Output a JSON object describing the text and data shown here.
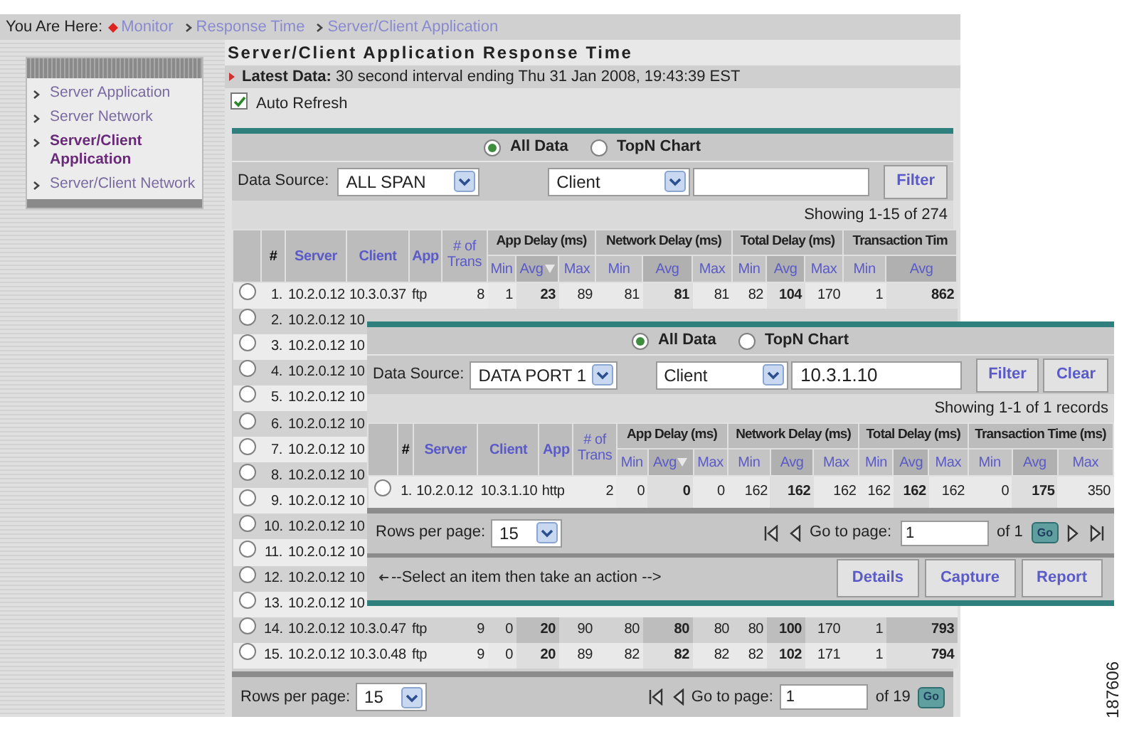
{
  "breadcrumb": {
    "label": "You Are Here:",
    "items": [
      {
        "label": "Monitor",
        "kind": "home"
      },
      {
        "label": "Response Time",
        "kind": "link"
      },
      {
        "label": "Server/Client Application",
        "kind": "link"
      }
    ]
  },
  "sidebar": {
    "items": [
      {
        "label": "Server Application",
        "selected": false
      },
      {
        "label": "Server Network",
        "selected": false
      },
      {
        "label": "Server/Client Application",
        "selected": true
      },
      {
        "label": "Server/Client Network",
        "selected": false
      }
    ]
  },
  "page_title": "Server/Client Application Response Time",
  "latest_data": "**Latest Data:** 30 second interval ending Thu 31 Jan 2008, 19:43:39 EST",
  "auto_refresh": {
    "label": "Auto Refresh",
    "checked": true
  },
  "main_panel": {
    "view_options": [
      {
        "label": "All Data",
        "selected": true
      },
      {
        "label": "TopN Chart",
        "selected": false
      }
    ],
    "data_source": {
      "label": "Data Source:",
      "value": "ALL SPAN"
    },
    "filter_by": "Client",
    "buttons": [
      "Filter"
    ],
    "showing": "Showing 1-15 of 274",
    "columns": [
      "#",
      "Server",
      "Client",
      "App",
      "# of Trans"
    ],
    "groups": [
      {
        "label": "App Delay (ms)",
        "subs": [
          {
            "label": "Min",
            "emphasis": false,
            "sorted": false
          },
          {
            "label": "Avg",
            "emphasis": true,
            "sorted": true
          },
          {
            "label": "Max",
            "emphasis": false,
            "sorted": false
          }
        ]
      },
      {
        "label": "Network Delay (ms)",
        "subs": [
          {
            "label": "Min",
            "emphasis": false,
            "sorted": false
          },
          {
            "label": "Avg",
            "emphasis": true,
            "sorted": false
          },
          {
            "label": "Max",
            "emphasis": false,
            "sorted": false
          }
        ]
      },
      {
        "label": "Total Delay (ms)",
        "subs": [
          {
            "label": "Min",
            "emphasis": false,
            "sorted": false
          },
          {
            "label": "Avg",
            "emphasis": true,
            "sorted": false
          },
          {
            "label": "Max",
            "emphasis": false,
            "sorted": false
          }
        ]
      },
      {
        "label": "Transaction Tim",
        "subs": [
          {
            "label": "Min",
            "emphasis": false,
            "sorted": false
          },
          {
            "label": "Avg",
            "emphasis": true,
            "sorted": false
          }
        ]
      }
    ],
    "rows": [
      {
        "number": "1.",
        "server": "10.2.0.12",
        "client": "10.3.0.37",
        "app": "ftp",
        "trans": "8",
        "values": [
          "1",
          "23",
          "89",
          "81",
          "81",
          "81",
          "82",
          "104",
          "170",
          "1",
          "862"
        ],
        "selected": false
      },
      {
        "number": "2.",
        "server": "10.2.0.12",
        "client": "10",
        "selected": false
      },
      {
        "number": "3.",
        "server": "10.2.0.12",
        "client": "10",
        "selected": false
      },
      {
        "number": "4.",
        "server": "10.2.0.12",
        "client": "10",
        "selected": false
      },
      {
        "number": "5.",
        "server": "10.2.0.12",
        "client": "10",
        "selected": false
      },
      {
        "number": "6.",
        "server": "10.2.0.12",
        "client": "10",
        "selected": false
      },
      {
        "number": "7.",
        "server": "10.2.0.12",
        "client": "10",
        "selected": false
      },
      {
        "number": "8.",
        "server": "10.2.0.12",
        "client": "10",
        "selected": false
      },
      {
        "number": "9.",
        "server": "10.2.0.12",
        "client": "10",
        "selected": false
      },
      {
        "number": "10.",
        "server": "10.2.0.12",
        "client": "10",
        "selected": false
      },
      {
        "number": "11.",
        "server": "10.2.0.12",
        "client": "10",
        "selected": false
      },
      {
        "number": "12.",
        "server": "10.2.0.12",
        "client": "10",
        "selected": false
      },
      {
        "number": "13.",
        "server": "10.2.0.12",
        "client": "10",
        "selected": false
      },
      {
        "number": "14.",
        "server": "10.2.0.12",
        "client": "10.3.0.47",
        "app": "ftp",
        "trans": "9",
        "values": [
          "0",
          "20",
          "90",
          "80",
          "80",
          "80",
          "80",
          "100",
          "170",
          "1",
          "793"
        ],
        "selected": false
      },
      {
        "number": "15.",
        "server": "10.2.0.12",
        "client": "10.3.0.48",
        "app": "ftp",
        "trans": "9",
        "values": [
          "0",
          "20",
          "89",
          "82",
          "82",
          "82",
          "82",
          "102",
          "171",
          "1",
          "794"
        ],
        "selected": false
      }
    ],
    "pagination": {
      "rows_label": "Rows per page:",
      "rows_value": "15",
      "goto_label": "Go to page:",
      "page": "1",
      "of": "of 19",
      "go": "Go"
    }
  },
  "overlay_panel": {
    "view_options": [
      {
        "label": "All Data",
        "selected": true
      },
      {
        "label": "TopN Chart",
        "selected": false
      }
    ],
    "data_source": {
      "label": "Data Source:",
      "value": "DATA PORT 1"
    },
    "filter_by": "Client",
    "filter_value": "10.3.1.10",
    "buttons": [
      "Filter",
      "Clear"
    ],
    "showing": "Showing 1-1 of 1 records",
    "columns": [
      "#",
      "Server",
      "Client",
      "App",
      "# of Trans"
    ],
    "groups": [
      {
        "label": "App Delay (ms)",
        "subs": [
          {
            "label": "Min",
            "emphasis": false,
            "sorted": false
          },
          {
            "label": "Avg",
            "emphasis": true,
            "sorted": true
          },
          {
            "label": "Max",
            "emphasis": false,
            "sorted": false
          }
        ]
      },
      {
        "label": "Network Delay (ms)",
        "subs": [
          {
            "label": "Min",
            "emphasis": false,
            "sorted": false
          },
          {
            "label": "Avg",
            "emphasis": true,
            "sorted": false
          },
          {
            "label": "Max",
            "emphasis": false,
            "sorted": false
          }
        ]
      },
      {
        "label": "Total Delay (ms)",
        "subs": [
          {
            "label": "Min",
            "emphasis": false,
            "sorted": false
          },
          {
            "label": "Avg",
            "emphasis": true,
            "sorted": false
          },
          {
            "label": "Max",
            "emphasis": false,
            "sorted": false
          }
        ]
      },
      {
        "label": "Transaction Time (ms)",
        "subs": [
          {
            "label": "Min",
            "emphasis": false,
            "sorted": false
          },
          {
            "label": "Avg",
            "emphasis": true,
            "sorted": false
          },
          {
            "label": "Max",
            "emphasis": false,
            "sorted": false
          }
        ]
      }
    ],
    "rows": [
      {
        "number": "1.",
        "server": "10.2.0.12",
        "client": "10.3.1.10",
        "app": "http",
        "trans": "2",
        "values": [
          "0",
          "0",
          "0",
          "162",
          "162",
          "162",
          "162",
          "162",
          "162",
          "0",
          "175",
          "350"
        ],
        "selected": false
      }
    ],
    "pagination": {
      "rows_label": "Rows per page:",
      "rows_value": "15",
      "goto_label": "Go to page:",
      "page": "1",
      "of": "of 1",
      "go": "Go"
    },
    "action_hint": "--Select an item then take an action -->",
    "actions": [
      "Details",
      "Capture",
      "Report"
    ]
  },
  "figure_number": "187606"
}
